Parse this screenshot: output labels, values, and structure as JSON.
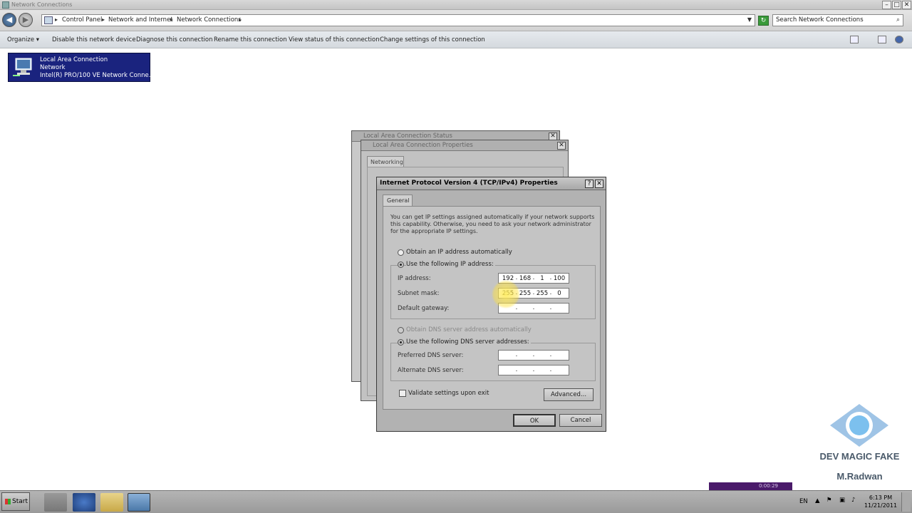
{
  "window": {
    "title": "Network Connections",
    "minimize": "–",
    "maximize": "□",
    "close": "✕"
  },
  "address": {
    "crumbs": [
      "Control Panel",
      "Network and Internet",
      "Network Connections"
    ],
    "search_placeholder": "Search Network Connections"
  },
  "toolbar": {
    "organize": "Organize",
    "disable": "Disable this network device",
    "diagnose": "Diagnose this connection",
    "rename": "Rename this connection",
    "view_status": "View status of this connection",
    "change_settings": "Change settings of this connection"
  },
  "connection": {
    "name": "Local Area Connection",
    "network": "Network",
    "adapter": "Intel(R) PRO/100 VE Network Conne..."
  },
  "dialog_back1": {
    "title": "Local Area Connection Status"
  },
  "dialog_back2": {
    "title": "Local Area Connection Properties",
    "tab": "Networking"
  },
  "ipv4": {
    "title": "Internet Protocol Version 4 (TCP/IPv4) Properties",
    "help": "?",
    "close": "✕",
    "tab": "General",
    "description": "You can get IP settings assigned automatically if your network supports this capability. Otherwise, you need to ask your network administrator for the appropriate IP settings.",
    "obtain_auto": "Obtain an IP address automatically",
    "use_following": "Use the following IP address:",
    "ip_label": "IP address:",
    "ip": [
      "192",
      "168",
      "1",
      "100"
    ],
    "mask_label": "Subnet mask:",
    "mask": [
      "255",
      "255",
      "255",
      "0"
    ],
    "gateway_label": "Default gateway:",
    "dns_auto": "Obtain DNS server address automatically",
    "dns_use": "Use the following DNS server addresses:",
    "pref_dns": "Preferred DNS server:",
    "alt_dns": "Alternate DNS server:",
    "validate": "Validate settings upon exit",
    "advanced": "Advanced...",
    "ok": "OK",
    "cancel": "Cancel",
    "dot": "."
  },
  "watermark": {
    "line1": "DEV MAGIC FAKE",
    "line2": "M.Radwan"
  },
  "recorder": {
    "time": "0:00:29"
  },
  "taskbar": {
    "start": "Start",
    "lang": "EN",
    "time": "6:13 PM",
    "date": "11/21/2011"
  }
}
